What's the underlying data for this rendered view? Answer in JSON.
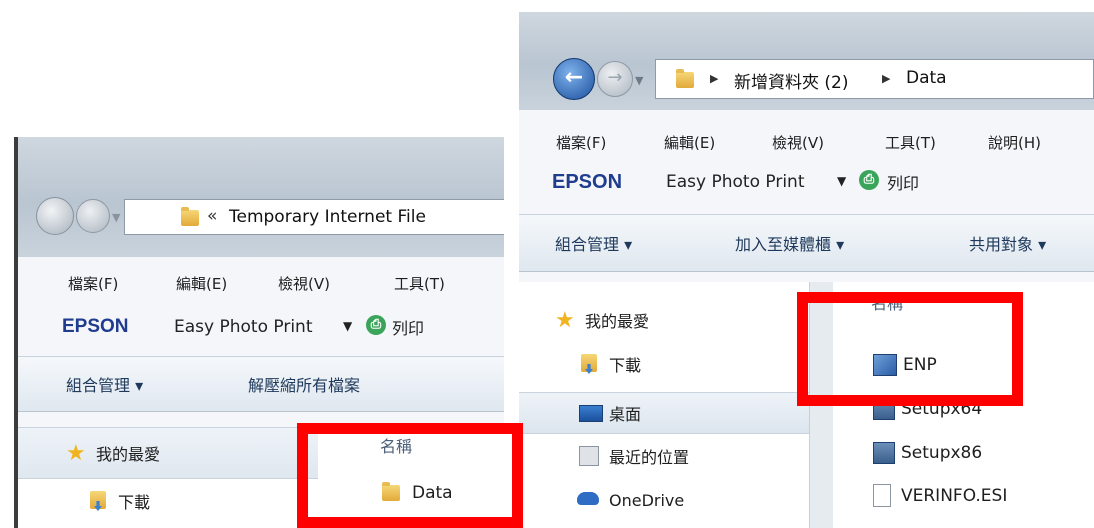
{
  "left_window": {
    "address_path": "Temporary Internet File",
    "menu": [
      "檔案(F)",
      "編輯(E)",
      "檢視(V)",
      "工具(T)"
    ],
    "epson_brand": "EPSON",
    "epson_app": "Easy Photo Print",
    "print_label": "列印",
    "toolbar": [
      "組合管理 ▾",
      "解壓縮所有檔案"
    ],
    "nav_items": [
      "我的最愛",
      "下載"
    ],
    "column_header": "名稱",
    "files": [
      "Data"
    ]
  },
  "right_window": {
    "breadcrumb": [
      "新增資料夾 (2)",
      "Data"
    ],
    "menu": [
      "檔案(F)",
      "編輯(E)",
      "檢視(V)",
      "工具(T)",
      "說明(H)"
    ],
    "epson_brand": "EPSON",
    "epson_app": "Easy Photo Print",
    "print_label": "列印",
    "toolbar": [
      "組合管理 ▾",
      "加入至媒體櫃 ▾",
      "共用對象 ▾"
    ],
    "nav_items": [
      "我的最愛",
      "下載",
      "桌面",
      "最近的位置",
      "OneDrive"
    ],
    "column_header": "名稱",
    "files": [
      "ENP",
      "Setupx64",
      "Setupx86",
      "VERINFO.ESI"
    ]
  },
  "colors": {
    "highlight_box": "#ff0000",
    "epson_blue": "#1f3c8f"
  }
}
